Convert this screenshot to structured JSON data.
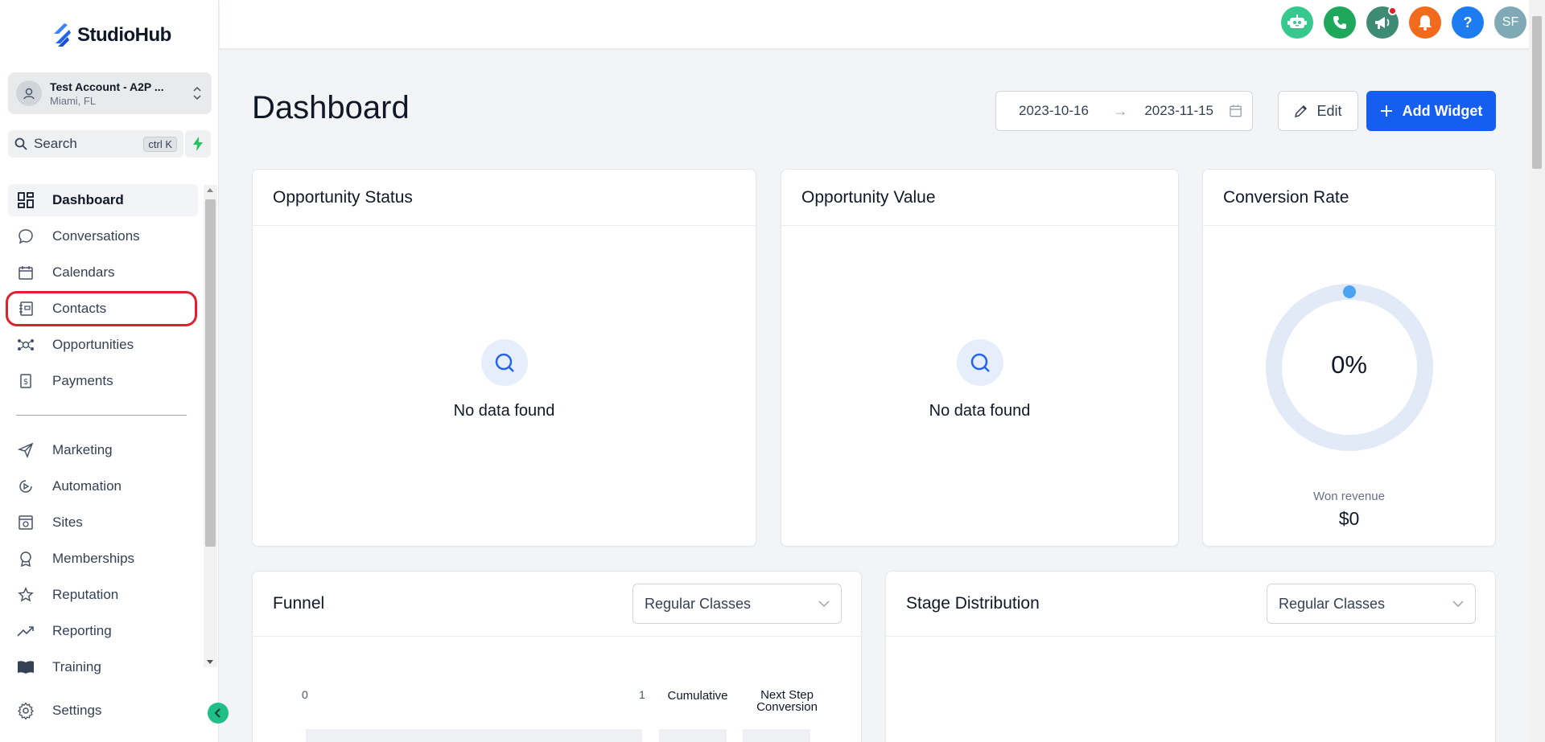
{
  "brand": {
    "name": "StudioHub",
    "accent": "#155eef"
  },
  "account": {
    "name": "Test Account - A2P ...",
    "location": "Miami, FL"
  },
  "search": {
    "label": "Search",
    "shortcut": "ctrl K"
  },
  "nav": {
    "primary": [
      {
        "label": "Dashboard",
        "icon": "dashboard-icon"
      },
      {
        "label": "Conversations",
        "icon": "chat-icon"
      },
      {
        "label": "Calendars",
        "icon": "calendar-icon"
      },
      {
        "label": "Contacts",
        "icon": "contacts-icon"
      },
      {
        "label": "Opportunities",
        "icon": "opportunities-icon"
      },
      {
        "label": "Payments",
        "icon": "payments-icon"
      }
    ],
    "secondary": [
      {
        "label": "Marketing",
        "icon": "send-icon"
      },
      {
        "label": "Automation",
        "icon": "automation-icon"
      },
      {
        "label": "Sites",
        "icon": "sites-icon"
      },
      {
        "label": "Memberships",
        "icon": "badge-icon"
      },
      {
        "label": "Reputation",
        "icon": "star-icon"
      },
      {
        "label": "Reporting",
        "icon": "trend-icon"
      },
      {
        "label": "Training",
        "icon": "book-icon"
      }
    ],
    "settings": {
      "label": "Settings",
      "icon": "gear-icon"
    }
  },
  "topbar": {
    "icons": [
      {
        "name": "bot-icon",
        "color": "#37c88f"
      },
      {
        "name": "phone-icon",
        "color": "#1fa85c"
      },
      {
        "name": "megaphone-icon",
        "color": "#3d8b73"
      },
      {
        "name": "bell-icon",
        "color": "#f26b1d"
      },
      {
        "name": "help-icon",
        "color": "#1d7cf2",
        "text": "?"
      },
      {
        "name": "user-avatar",
        "color": "#7fa9b5",
        "text": "SF"
      }
    ]
  },
  "page": {
    "title": "Dashboard",
    "date_start": "2023-10-16",
    "date_end": "2023-11-15",
    "edit_label": "Edit",
    "add_widget_label": "Add Widget"
  },
  "widgets": {
    "opportunity_status": {
      "title": "Opportunity Status",
      "empty": "No data found"
    },
    "opportunity_value": {
      "title": "Opportunity Value",
      "empty": "No data found"
    },
    "conversion_rate": {
      "title": "Conversion Rate",
      "value_text": "0%",
      "value": 0,
      "caption": "Won revenue",
      "revenue": "$0"
    },
    "funnel": {
      "title": "Funnel",
      "pipeline": "Regular Classes",
      "axis_start": "0",
      "axis_end": "1",
      "col_cumulative": "Cumulative",
      "col_next_step": "Next Step Conversion"
    },
    "stage_distribution": {
      "title": "Stage Distribution",
      "pipeline": "Regular Classes"
    }
  }
}
